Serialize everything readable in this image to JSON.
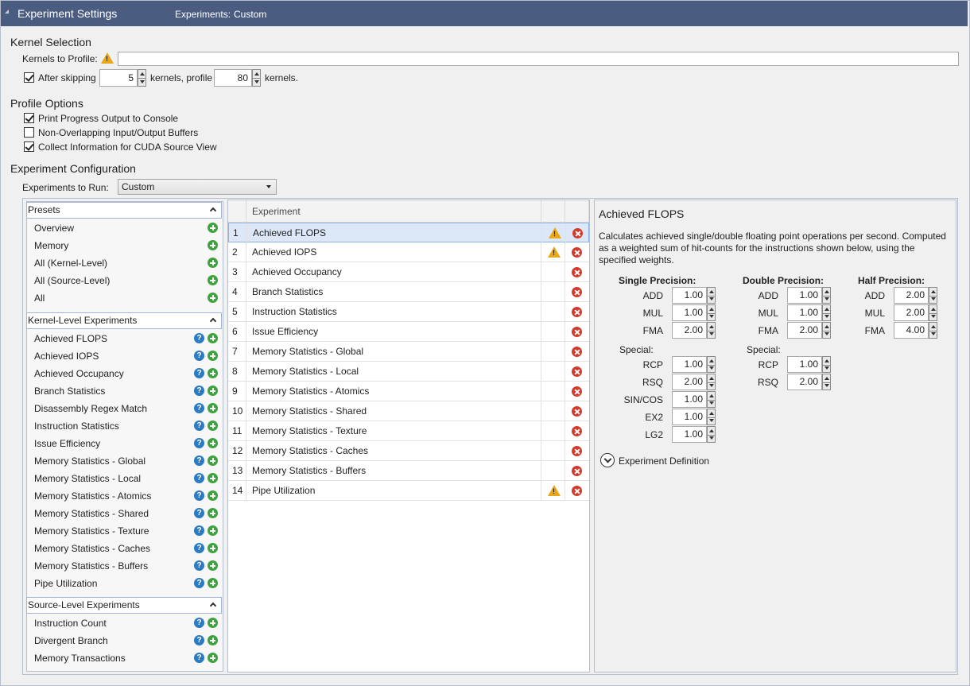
{
  "title": {
    "panel": "Experiment Settings",
    "experiments_label": "Experiments:",
    "experiments_value": "Custom"
  },
  "kernel_selection": {
    "heading": "Kernel Selection",
    "kernels_to_profile_label": "Kernels to Profile:",
    "kernels_to_profile_value": "",
    "after_skipping_label": "After skipping",
    "after_skipping_checked": true,
    "skip_value": "5",
    "kernels_profile_label": "kernels, profile",
    "profile_value": "80",
    "kernels_label": "kernels."
  },
  "profile_options": {
    "heading": "Profile Options",
    "items": [
      {
        "label": "Print Progress Output to Console",
        "checked": true
      },
      {
        "label": "Non-Overlapping Input/Output Buffers",
        "checked": false
      },
      {
        "label": "Collect Information for CUDA Source View",
        "checked": true
      }
    ]
  },
  "experiment_config": {
    "heading": "Experiment Configuration",
    "to_run_label": "Experiments to Run:",
    "to_run_value": "Custom"
  },
  "presets": {
    "heading": "Presets",
    "items": [
      "Overview",
      "Memory",
      "All (Kernel-Level)",
      "All (Source-Level)",
      "All"
    ]
  },
  "kernel_level": {
    "heading": "Kernel-Level Experiments",
    "items": [
      "Achieved FLOPS",
      "Achieved IOPS",
      "Achieved Occupancy",
      "Branch Statistics",
      "Disassembly Regex Match",
      "Instruction Statistics",
      "Issue Efficiency",
      "Memory Statistics - Global",
      "Memory Statistics - Local",
      "Memory Statistics - Atomics",
      "Memory Statistics - Shared",
      "Memory Statistics - Texture",
      "Memory Statistics - Caches",
      "Memory Statistics - Buffers",
      "Pipe Utilization"
    ]
  },
  "source_level": {
    "heading": "Source-Level Experiments",
    "items": [
      "Instruction Count",
      "Divergent Branch",
      "Memory Transactions"
    ]
  },
  "table": {
    "header": "Experiment",
    "rows": [
      {
        "n": "1",
        "name": "Achieved FLOPS",
        "warn": true
      },
      {
        "n": "2",
        "name": "Achieved IOPS",
        "warn": true
      },
      {
        "n": "3",
        "name": "Achieved Occupancy",
        "warn": false
      },
      {
        "n": "4",
        "name": "Branch Statistics",
        "warn": false
      },
      {
        "n": "5",
        "name": "Instruction Statistics",
        "warn": false
      },
      {
        "n": "6",
        "name": "Issue Efficiency",
        "warn": false
      },
      {
        "n": "7",
        "name": "Memory Statistics - Global",
        "warn": false
      },
      {
        "n": "8",
        "name": "Memory Statistics - Local",
        "warn": false
      },
      {
        "n": "9",
        "name": "Memory Statistics - Atomics",
        "warn": false
      },
      {
        "n": "10",
        "name": "Memory Statistics - Shared",
        "warn": false
      },
      {
        "n": "11",
        "name": "Memory Statistics - Texture",
        "warn": false
      },
      {
        "n": "12",
        "name": "Memory Statistics - Caches",
        "warn": false
      },
      {
        "n": "13",
        "name": "Memory Statistics - Buffers",
        "warn": false
      },
      {
        "n": "14",
        "name": "Pipe Utilization",
        "warn": true
      }
    ]
  },
  "details": {
    "title": "Achieved FLOPS",
    "description_lines": [
      "Calculates achieved single/double floating point operations per second. Computed",
      "as a weighted sum of hit-counts for the instructions shown below, using the",
      "specified weights."
    ],
    "single": {
      "heading": "Single Precision:",
      "ADD": "1.00",
      "MUL": "1.00",
      "FMA": "2.00",
      "special_label": "Special:",
      "RCP": "1.00",
      "RSQ": "2.00",
      "SINCOS": "1.00",
      "EX2": "1.00",
      "LG2": "1.00"
    },
    "double": {
      "heading": "Double Precision:",
      "ADD": "1.00",
      "MUL": "1.00",
      "FMA": "2.00",
      "special_label": "Special:",
      "RCP": "1.00",
      "RSQ": "2.00"
    },
    "half": {
      "heading": "Half Precision:",
      "ADD": "2.00",
      "MUL": "2.00",
      "FMA": "4.00"
    },
    "labels": {
      "add": "ADD",
      "mul": "MUL",
      "fma": "FMA",
      "rcp": "RCP",
      "rsq": "RSQ",
      "sincos": "SIN/COS",
      "ex2": "EX2",
      "lg2": "LG2"
    },
    "definition_label": "Experiment Definition"
  },
  "colors": {
    "titlebar": "#4a5d80",
    "selection": "#dce8f7",
    "add": "#3da33d",
    "help": "#2a7bc5",
    "remove": "#d23a2a",
    "warn": "#e8a817"
  },
  "icons": {
    "add": "plus-circle-icon",
    "help": "question-circle-icon",
    "remove": "x-circle-icon",
    "warn": "warning-icon"
  }
}
